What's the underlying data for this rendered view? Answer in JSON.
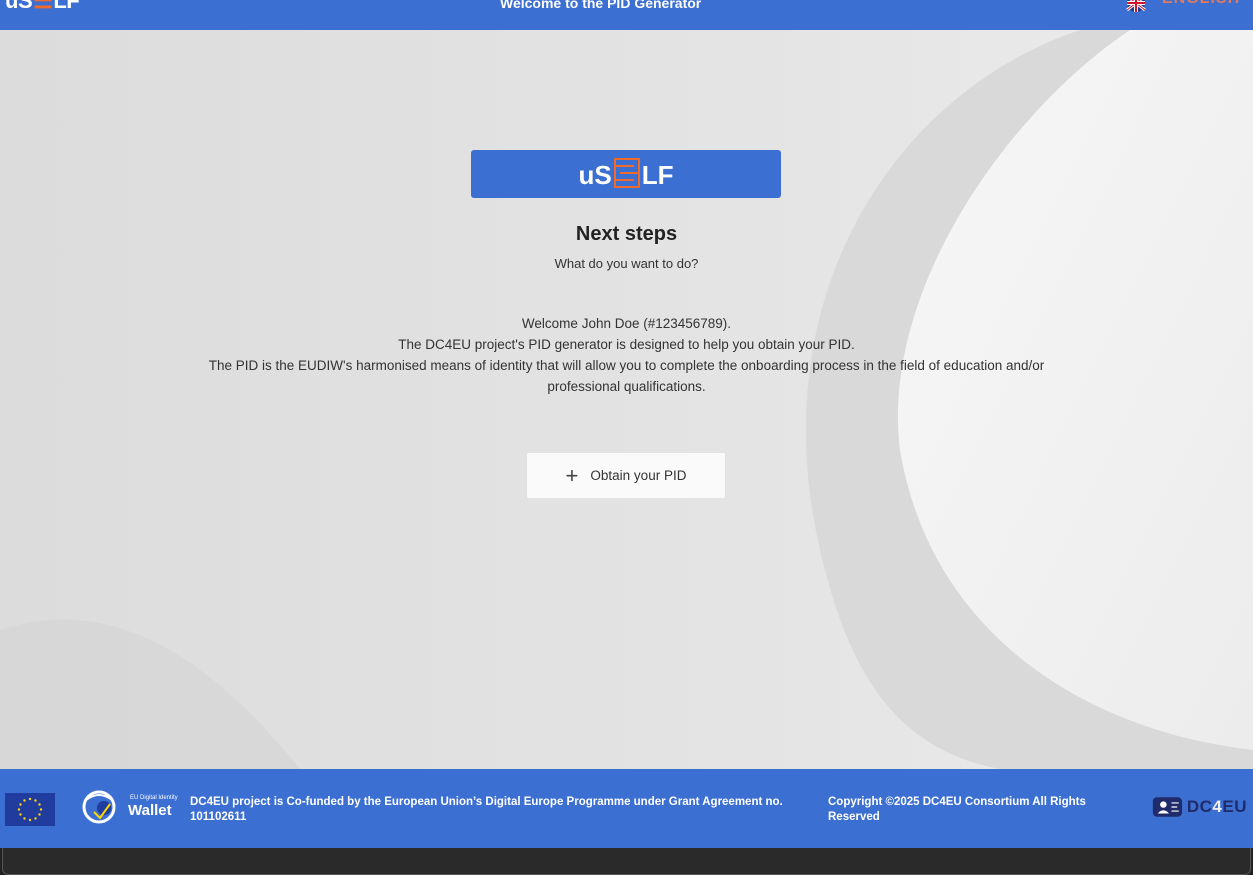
{
  "header": {
    "logo_left": "uS",
    "logo_right": "LF",
    "title": "Welcome to the PID Generator",
    "language_label": "ENGLISH"
  },
  "main": {
    "brand_left": "uS",
    "brand_right": "LF",
    "heading": "Next steps",
    "subheading": "What do you want to do?",
    "welcome": "Welcome John Doe (#123456789).",
    "line2": "The DC4EU project's PID generator is designed to help you obtain your PID.",
    "line3": "The PID is the EUDIW's harmonised means of identity that will allow you to complete the onboarding process in the field of education and/or professional qualifications.",
    "button_label": "Obtain your PID",
    "button_icon": "plus-icon"
  },
  "footer": {
    "wallet_small": "EU Digital Identity",
    "wallet_big": "Wallet",
    "funding_text": "DC4EU project is Co-funded by the European Union’s Digital Europe Programme under Grant Agreement no. 101102611",
    "copyright": "Copyright ©2025 DC4EU Consortium All Rights Reserved",
    "dc_logo_text_a": "DC",
    "dc_logo_text_b": "4",
    "dc_logo_text_c": "EU"
  },
  "colors": {
    "brand_blue": "#3b6fd1",
    "accent_orange": "#f06a2c",
    "background": "#e6e6e6"
  }
}
